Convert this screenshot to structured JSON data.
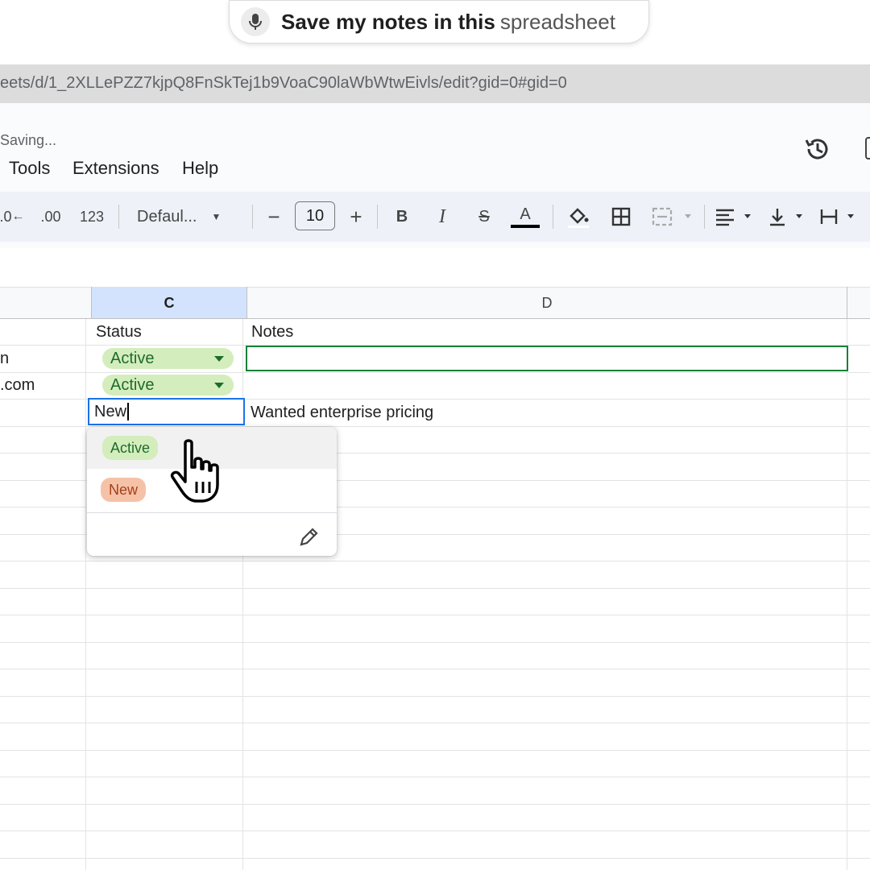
{
  "voice": {
    "icon": "microphone-icon",
    "text_bold": "Save my notes in this",
    "text_soft": "spreadsheet"
  },
  "browser": {
    "url": "eets/d/1_2XLLePZZ7kjpQ8FnSkTej1b9VoaC90laWbWtwEivls/edit?gid=0#gid=0"
  },
  "header": {
    "status": "Saving...",
    "menu": [
      "Tools",
      "Extensions",
      "Help"
    ],
    "history_icon": "history-icon"
  },
  "toolbar": {
    "decrease_decimal": ".0",
    "increase_decimal": ".00",
    "number_format": "123",
    "font_name": "Defaul...",
    "minus": "−",
    "font_size": "10",
    "plus": "+",
    "bold": "B",
    "italic": "I",
    "strike": "S",
    "text_color": "A"
  },
  "grid": {
    "columns": [
      "C",
      "D"
    ],
    "headers": {
      "status": "Status",
      "notes": "Notes"
    },
    "rows": [
      {
        "b_fragment": "n",
        "status": "Active",
        "notes": ""
      },
      {
        "b_fragment": ".com",
        "status": "Active",
        "notes": ""
      },
      {
        "b_fragment": "",
        "status_editing": "New",
        "notes": "Wanted enterprise pricing"
      }
    ]
  },
  "dropdown": {
    "options": [
      {
        "label": "Active",
        "bg": "#d4edbc",
        "fg": "#1e6b2e"
      },
      {
        "label": "New",
        "bg": "#f5c2a8",
        "fg": "#a5401a"
      }
    ],
    "edit_icon": "pencil-icon"
  },
  "colors": {
    "accent_blue": "#1a73e8",
    "selection_green": "#188038",
    "header_blue": "#d3e3fd"
  }
}
